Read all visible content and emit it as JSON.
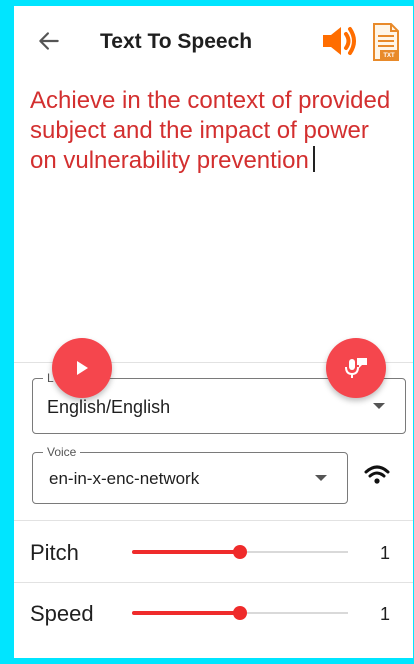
{
  "header": {
    "title": "Text To Speech",
    "back_icon": "arrow-left-icon",
    "speaker_icon": "volume-icon",
    "txt_icon": "txt-file-icon",
    "txt_icon_text": "TXT"
  },
  "editor": {
    "text": "Achieve in the context of provided subject and the impact of power on vulnerability prevention"
  },
  "fabs": {
    "play_icon": "play-icon",
    "mic_icon": "voice-input-icon"
  },
  "language": {
    "label": "L",
    "value": "English/English"
  },
  "voice": {
    "label": "Voice",
    "value": "en-in-x-enc-network",
    "network_icon": "wifi-icon"
  },
  "pitch": {
    "label": "Pitch",
    "value": "1",
    "fraction": 0.5
  },
  "speed": {
    "label": "Speed",
    "value": "1",
    "fraction": 0.5
  },
  "colors": {
    "accent": "#ef2b2b",
    "fab": "#f5464d",
    "text_red": "#d32f2f",
    "speaker_orange": "#ff6d00",
    "border_cyan": "#00e5ff"
  }
}
